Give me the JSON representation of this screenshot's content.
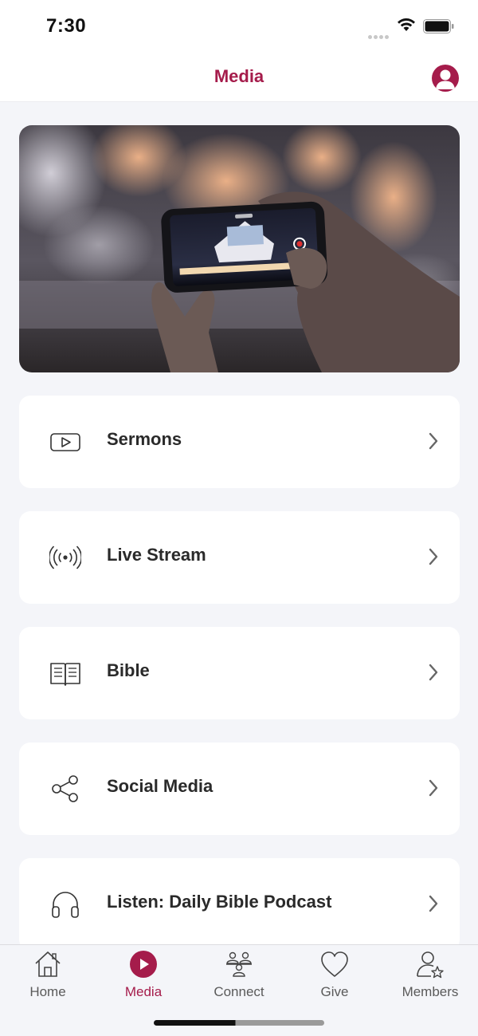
{
  "status_bar": {
    "time": "7:30"
  },
  "nav": {
    "title": "Media"
  },
  "hero": {
    "image": "phone-recording-concert-photo"
  },
  "menu": [
    {
      "label": "Sermons",
      "icon": "video-play-icon"
    },
    {
      "label": "Live Stream",
      "icon": "broadcast-icon"
    },
    {
      "label": "Bible",
      "icon": "open-book-icon"
    },
    {
      "label": "Social Media",
      "icon": "share-icon"
    },
    {
      "label": "Listen: Daily Bible Podcast",
      "icon": "headphones-icon"
    }
  ],
  "tabs": [
    {
      "label": "Home",
      "icon": "home-icon",
      "active": false
    },
    {
      "label": "Media",
      "icon": "play-circle-icon",
      "active": true
    },
    {
      "label": "Connect",
      "icon": "people-icon",
      "active": false
    },
    {
      "label": "Give",
      "icon": "heart-icon",
      "active": false
    },
    {
      "label": "Members",
      "icon": "member-star-icon",
      "active": false
    }
  ],
  "colors": {
    "accent": "#a51c4b",
    "background": "#f4f5f9",
    "card": "#ffffff"
  }
}
